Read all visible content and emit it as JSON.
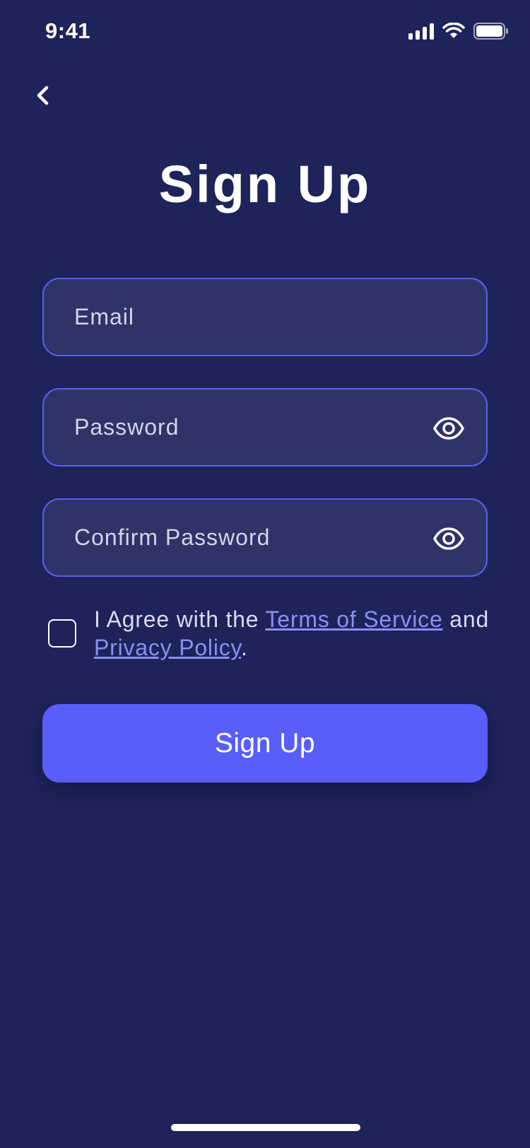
{
  "status_bar": {
    "time": "9:41"
  },
  "page": {
    "title": "Sign Up"
  },
  "form": {
    "email_placeholder": "Email",
    "password_placeholder": "Password",
    "confirm_placeholder": "Confirm Password",
    "agree_prefix": "I Agree with the ",
    "terms_link": "Terms of Service",
    "agree_middle": " and ",
    "privacy_link": "Privacy Policy",
    "agree_suffix": ".",
    "submit_label": "Sign Up"
  },
  "colors": {
    "background": "#1e245a",
    "field_bg": "#2e3468",
    "accent": "#5a5ef9",
    "link": "#8a8ff5"
  },
  "icons": [
    "back-chevron-icon",
    "signal-icon",
    "wifi-icon",
    "battery-icon",
    "eye-icon"
  ]
}
